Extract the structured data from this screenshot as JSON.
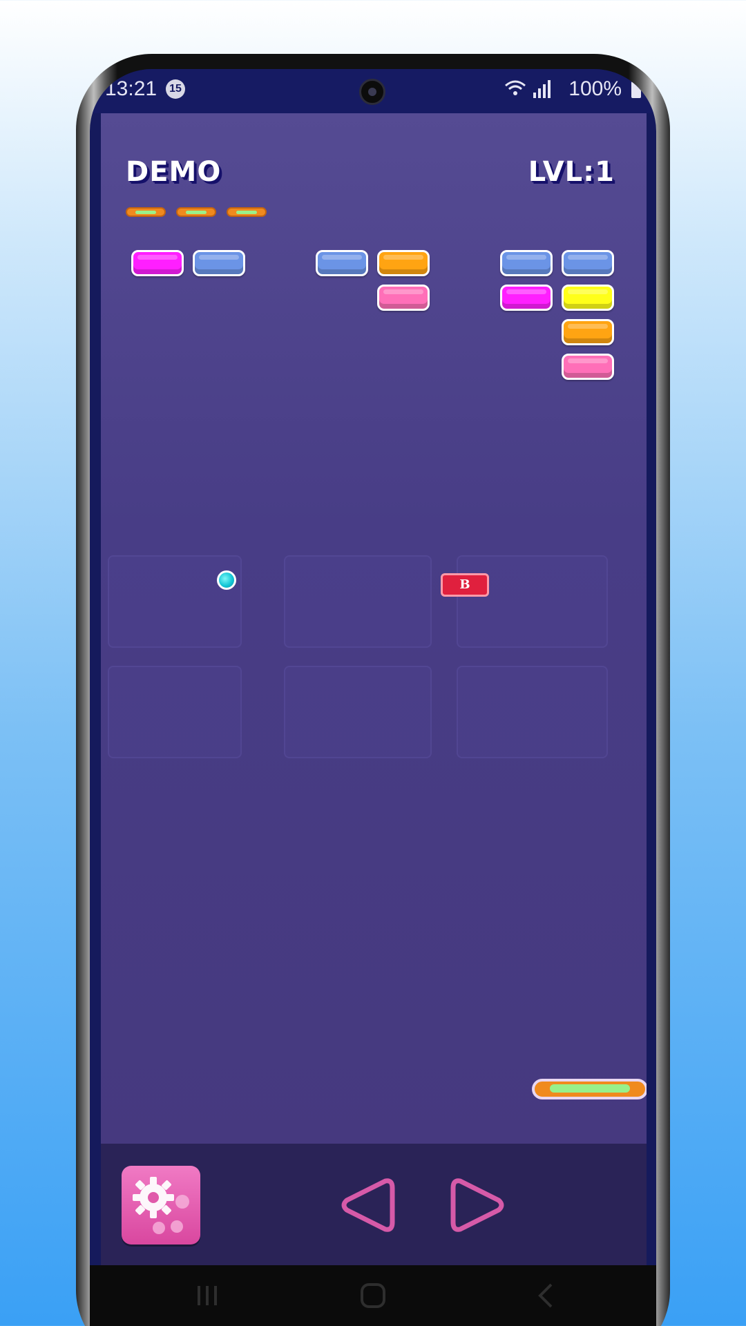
{
  "status_bar": {
    "time": "13:21",
    "notification_count": "15",
    "battery": "100%"
  },
  "hud": {
    "mode_label": "DEMO",
    "level_label": "LVL:1",
    "lives": 3
  },
  "bricks": [
    {
      "color": "#ff1fff"
    },
    {
      "color": "#6b94e6"
    },
    {
      "color": "#6b94e6"
    },
    {
      "color": "#ffa412"
    },
    {
      "color": "#ff6fb8"
    },
    {
      "color": "#6b94e6"
    },
    {
      "color": "#6b94e6"
    },
    {
      "color": "#ff1fff"
    },
    {
      "color": "#ffff1a"
    },
    {
      "color": "#ffa412"
    },
    {
      "color": "#ff6fb8"
    }
  ],
  "powerup": {
    "label": "B",
    "color": "#e0203e"
  },
  "controls": {
    "settings_icon": "gear-icon",
    "left_icon": "triangle-left-icon",
    "right_icon": "triangle-right-icon"
  },
  "colors": {
    "game_background": "#483d86",
    "paddle": "#f08a1e",
    "ball": "#14c7d6",
    "control_accent": "#d9479f"
  }
}
